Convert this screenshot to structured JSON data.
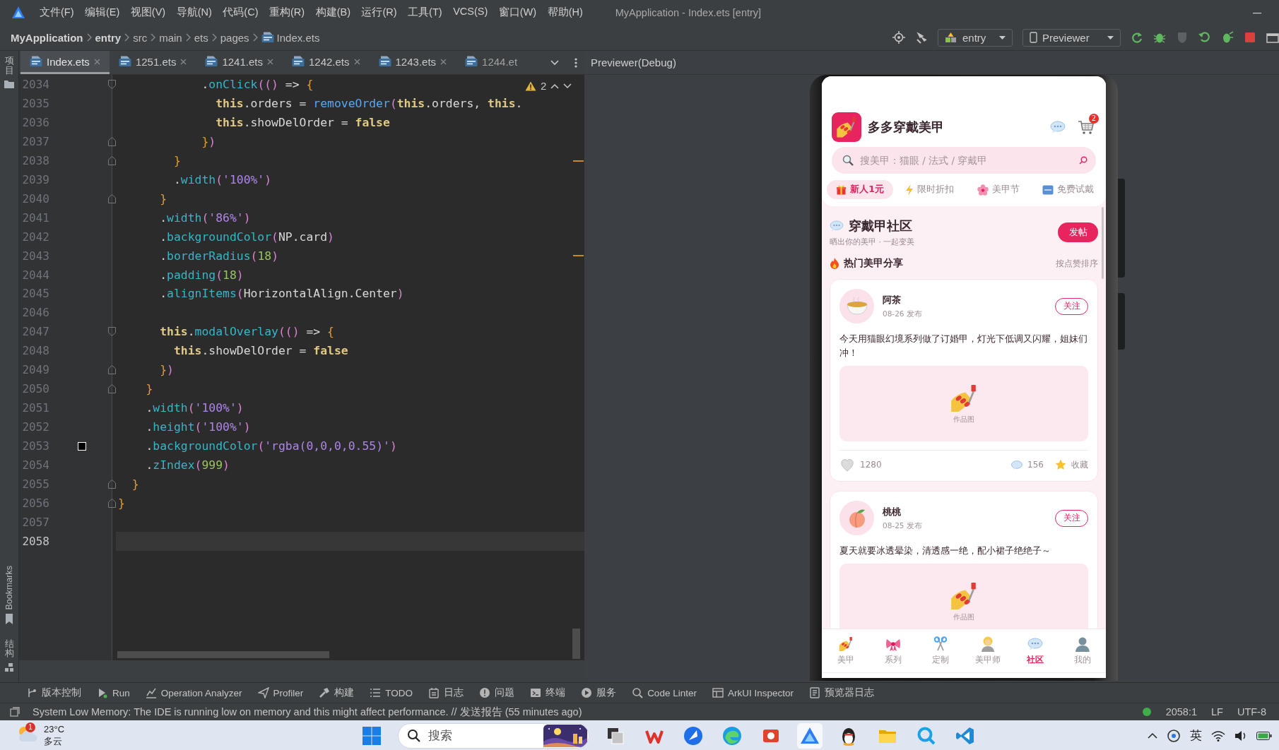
{
  "menu_bar": {
    "items": [
      "文件(F)",
      "编辑(E)",
      "视图(V)",
      "导航(N)",
      "代码(C)",
      "重构(R)",
      "构建(B)",
      "运行(R)",
      "工具(T)",
      "VCS(S)",
      "窗口(W)",
      "帮助(H)"
    ],
    "window_title": "MyApplication - Index.ets [entry]"
  },
  "breadcrumb": [
    {
      "label": "MyApplication",
      "kind": "module"
    },
    {
      "label": "entry",
      "kind": "module"
    },
    {
      "label": "src",
      "kind": "folder"
    },
    {
      "label": "main",
      "kind": "folder"
    },
    {
      "label": "ets",
      "kind": "folder"
    },
    {
      "label": "pages",
      "kind": "folder"
    },
    {
      "label": "Index.ets",
      "kind": "file"
    }
  ],
  "run_toolbar": {
    "module": "entry",
    "device": "Previewer"
  },
  "left_strip": [
    {
      "label": "项目",
      "kind": "project"
    },
    {
      "label": "Bookmarks",
      "kind": "bookmarks"
    },
    {
      "label": "结构",
      "kind": "structure"
    }
  ],
  "editor_tabs": [
    {
      "label": "Index.ets",
      "selected": true,
      "close_button": true
    },
    {
      "label": "1251.ets",
      "selected": false,
      "close_button": true
    },
    {
      "label": "1241.ets",
      "selected": false,
      "close_button": true
    },
    {
      "label": "1242.ets",
      "selected": false,
      "close_button": true
    },
    {
      "label": "1243.ets",
      "selected": false,
      "close_button": true
    },
    {
      "label": "1244.et",
      "selected": false,
      "close_button": false
    }
  ],
  "editor": {
    "warnings": "2",
    "lines": [
      {
        "number": "2034",
        "fold": {
          "kind": "start"
        },
        "current": false,
        "tokens": [
          {
            "kind": "p",
            "text": "            ."
          },
          {
            "kind": "fn",
            "text": "onClick"
          },
          {
            "kind": "pa",
            "text": "(()"
          },
          {
            "kind": "p",
            "text": " => "
          },
          {
            "kind": "br",
            "text": "{"
          }
        ]
      },
      {
        "number": "2035",
        "current": false,
        "tokens": [
          {
            "kind": "kw",
            "text": "              this"
          },
          {
            "kind": "p",
            "text": ".orders = "
          },
          {
            "kind": "call",
            "text": "removeOrder"
          },
          {
            "kind": "pa",
            "text": "("
          },
          {
            "kind": "kw",
            "text": "this"
          },
          {
            "kind": "p",
            "text": ".orders, "
          },
          {
            "kind": "kw",
            "text": "this"
          },
          {
            "kind": "p",
            "text": "."
          }
        ]
      },
      {
        "number": "2036",
        "current": false,
        "tokens": [
          {
            "kind": "kw",
            "text": "              this"
          },
          {
            "kind": "p",
            "text": ".showDelOrder = "
          },
          {
            "kind": "kw",
            "text": "false"
          }
        ]
      },
      {
        "number": "2037",
        "fold": {
          "kind": "end"
        },
        "current": false,
        "tokens": [
          {
            "kind": "br",
            "text": "            }"
          },
          {
            "kind": "pa",
            "text": ")"
          }
        ]
      },
      {
        "number": "2038",
        "fold": {
          "kind": "end"
        },
        "current": false,
        "tokens": [
          {
            "kind": "br",
            "text": "        }"
          }
        ]
      },
      {
        "number": "2039",
        "current": false,
        "tokens": [
          {
            "kind": "p",
            "text": "        ."
          },
          {
            "kind": "fn",
            "text": "width"
          },
          {
            "kind": "pa",
            "text": "("
          },
          {
            "kind": "str",
            "text": "'100%'"
          },
          {
            "kind": "pa",
            "text": ")"
          }
        ]
      },
      {
        "number": "2040",
        "fold": {
          "kind": "end"
        },
        "current": false,
        "tokens": [
          {
            "kind": "br",
            "text": "      }"
          }
        ]
      },
      {
        "number": "2041",
        "current": false,
        "tokens": [
          {
            "kind": "p",
            "text": "      ."
          },
          {
            "kind": "fn",
            "text": "width"
          },
          {
            "kind": "pa",
            "text": "("
          },
          {
            "kind": "str",
            "text": "'86%'"
          },
          {
            "kind": "pa",
            "text": ")"
          }
        ]
      },
      {
        "number": "2042",
        "current": false,
        "tokens": [
          {
            "kind": "p",
            "text": "      ."
          },
          {
            "kind": "fn",
            "text": "backgroundColor"
          },
          {
            "kind": "pa",
            "text": "("
          },
          {
            "kind": "p",
            "text": "NP.card"
          },
          {
            "kind": "pa",
            "text": ")"
          }
        ]
      },
      {
        "number": "2043",
        "current": false,
        "tokens": [
          {
            "kind": "p",
            "text": "      ."
          },
          {
            "kind": "fn",
            "text": "borderRadius"
          },
          {
            "kind": "pa",
            "text": "("
          },
          {
            "kind": "num",
            "text": "18"
          },
          {
            "kind": "pa",
            "text": ")"
          }
        ]
      },
      {
        "number": "2044",
        "current": false,
        "tokens": [
          {
            "kind": "p",
            "text": "      ."
          },
          {
            "kind": "fn",
            "text": "padding"
          },
          {
            "kind": "pa",
            "text": "("
          },
          {
            "kind": "num",
            "text": "18"
          },
          {
            "kind": "pa",
            "text": ")"
          }
        ]
      },
      {
        "number": "2045",
        "current": false,
        "tokens": [
          {
            "kind": "p",
            "text": "      ."
          },
          {
            "kind": "fn",
            "text": "alignItems"
          },
          {
            "kind": "pa",
            "text": "("
          },
          {
            "kind": "p",
            "text": "HorizontalAlign.Center"
          },
          {
            "kind": "pa",
            "text": ")"
          }
        ]
      },
      {
        "number": "2046",
        "current": false
      },
      {
        "number": "2047",
        "fold": {
          "kind": "start"
        },
        "current": false,
        "tokens": [
          {
            "kind": "kw",
            "text": "      this"
          },
          {
            "kind": "p",
            "text": "."
          },
          {
            "kind": "fn",
            "text": "modalOverlay"
          },
          {
            "kind": "pa",
            "text": "(()"
          },
          {
            "kind": "p",
            "text": " => "
          },
          {
            "kind": "br",
            "text": "{"
          }
        ]
      },
      {
        "number": "2048",
        "current": false,
        "tokens": [
          {
            "kind": "kw",
            "text": "        this"
          },
          {
            "kind": "p",
            "text": ".showDelOrder = "
          },
          {
            "kind": "kw",
            "text": "false"
          }
        ]
      },
      {
        "number": "2049",
        "fold": {
          "kind": "end"
        },
        "current": false,
        "tokens": [
          {
            "kind": "br",
            "text": "      }"
          },
          {
            "kind": "pa",
            "text": ")"
          }
        ]
      },
      {
        "number": "2050",
        "fold": {
          "kind": "end"
        },
        "current": false,
        "tokens": [
          {
            "kind": "br",
            "text": "    }"
          }
        ]
      },
      {
        "number": "2051",
        "current": false,
        "tokens": [
          {
            "kind": "p",
            "text": "    ."
          },
          {
            "kind": "fn",
            "text": "width"
          },
          {
            "kind": "pa",
            "text": "("
          },
          {
            "kind": "str",
            "text": "'100%'"
          },
          {
            "kind": "pa",
            "text": ")"
          }
        ]
      },
      {
        "number": "2052",
        "current": false,
        "tokens": [
          {
            "kind": "p",
            "text": "    ."
          },
          {
            "kind": "fn",
            "text": "height"
          },
          {
            "kind": "pa",
            "text": "("
          },
          {
            "kind": "str",
            "text": "'100%'"
          },
          {
            "kind": "pa",
            "text": ")"
          }
        ]
      },
      {
        "number": "2053",
        "color": "#000000",
        "current": false,
        "tokens": [
          {
            "kind": "p",
            "text": "    ."
          },
          {
            "kind": "fn",
            "text": "backgroundColor"
          },
          {
            "kind": "pa",
            "text": "("
          },
          {
            "kind": "str",
            "text": "'rgba(0,0,0,0.55)'"
          },
          {
            "kind": "pa",
            "text": ")"
          }
        ]
      },
      {
        "number": "2054",
        "current": false,
        "tokens": [
          {
            "kind": "p",
            "text": "    ."
          },
          {
            "kind": "fn",
            "text": "zIndex"
          },
          {
            "kind": "pa",
            "text": "("
          },
          {
            "kind": "num",
            "text": "999"
          },
          {
            "kind": "pa",
            "text": ")"
          }
        ]
      },
      {
        "number": "2055",
        "fold": {
          "kind": "end"
        },
        "current": false,
        "tokens": [
          {
            "kind": "br",
            "text": "  }"
          }
        ]
      },
      {
        "number": "2056",
        "fold": {
          "kind": "end"
        },
        "current": false,
        "tokens": [
          {
            "kind": "br",
            "text": "}"
          }
        ]
      },
      {
        "number": "2057",
        "current": false
      },
      {
        "number": "2058",
        "current": true
      }
    ]
  },
  "previewer": {
    "title": "Previewer(Debug)",
    "app": {
      "title": "多多穿戴美甲",
      "cart_badge": "2",
      "search_placeholder": "搜美甲：猫眼 / 法式 / 穿戴甲",
      "categories": [
        {
          "label": "新人1元",
          "kind": "gift",
          "selected": true
        },
        {
          "label": "限时折扣",
          "kind": "flash",
          "selected": false
        },
        {
          "label": "美甲节",
          "kind": "flower",
          "selected": false
        },
        {
          "label": "免费试戴",
          "kind": "free",
          "selected": false
        }
      ],
      "community": {
        "title": "穿戴甲社区",
        "subtitle": "晒出你的美甲 · 一起变美",
        "post_button": "发帖"
      },
      "feed": {
        "title": "热门美甲分享",
        "sort": "按点赞排序"
      },
      "posts": [
        {
          "author": "阿茶",
          "avatar": {
            "kind": "tea"
          },
          "time": "08-26 发布",
          "follow": "关注",
          "text": "今天用猫眼幻境系列做了订婚甲，灯光下低调又闪耀，姐妹们冲！",
          "image_caption": "作品图",
          "likes": "1280",
          "liked": false,
          "comments": "156",
          "favorite": "收藏"
        },
        {
          "author": "桃桃",
          "avatar": {
            "kind": "peach"
          },
          "time": "08-25 发布",
          "follow": "关注",
          "text": "夏天就要冰透晕染，清透感一绝，配小裙子绝绝子～",
          "image_caption": "作品图"
        }
      ],
      "tab_bar": [
        {
          "label": "美甲",
          "kind": "nail",
          "selected": false
        },
        {
          "label": "系列",
          "kind": "bow",
          "selected": false
        },
        {
          "label": "定制",
          "kind": "scissors",
          "selected": false
        },
        {
          "label": "美甲师",
          "kind": "stylist",
          "selected": false
        },
        {
          "label": "社区",
          "kind": "chat",
          "selected": true
        },
        {
          "label": "我的",
          "kind": "person",
          "selected": false
        }
      ]
    }
  },
  "tool_windows": [
    {
      "label": "版本控制",
      "kind": "vcs"
    },
    {
      "label": "Run",
      "kind": "run"
    },
    {
      "label": "Operation Analyzer",
      "kind": "analyzer"
    },
    {
      "label": "Profiler",
      "kind": "profiler"
    },
    {
      "label": "构建",
      "kind": "build"
    },
    {
      "label": "TODO",
      "kind": "todo"
    },
    {
      "label": "日志",
      "kind": "log"
    },
    {
      "label": "问题",
      "kind": "problems"
    },
    {
      "label": "终端",
      "kind": "terminal"
    },
    {
      "label": "服务",
      "kind": "services"
    },
    {
      "label": "Code Linter",
      "kind": "linter"
    },
    {
      "label": "ArkUI Inspector",
      "kind": "inspector"
    },
    {
      "label": "预览器日志",
      "kind": "previewer_log"
    }
  ],
  "status_bar": {
    "message": "System Low Memory: The IDE is running low on memory and this might affect performance. // 发送报告 (55 minutes ago)",
    "position": "2058:1",
    "line_ending": "LF",
    "encoding": "UTF-8"
  },
  "taskbar": {
    "weather": {
      "alert_badge": "1",
      "temperature": "23°C",
      "condition": "多云"
    },
    "search_placeholder": "搜索",
    "apps": [
      {
        "kind": "stack",
        "selected": false
      },
      {
        "kind": "zigzag",
        "selected": false
      },
      {
        "kind": "bird",
        "selected": false
      },
      {
        "kind": "swirl",
        "selected": false
      },
      {
        "kind": "slides",
        "selected": false
      },
      {
        "kind": "triangle",
        "selected": true
      },
      {
        "kind": "penguin",
        "selected": false
      },
      {
        "kind": "folder",
        "selected": false
      },
      {
        "kind": "lens",
        "selected": false
      },
      {
        "kind": "code",
        "selected": false
      }
    ],
    "input_method": "英"
  }
}
